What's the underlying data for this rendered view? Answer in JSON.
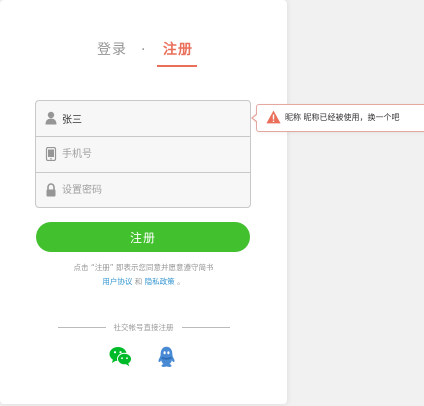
{
  "tabs": {
    "login": "登录",
    "separator": "·",
    "register": "注册"
  },
  "form": {
    "nickname_value": "张三",
    "phone_placeholder": "手机号",
    "password_placeholder": "设置密码"
  },
  "tooltip": {
    "message": "昵称 昵称已经被使用，换一个吧"
  },
  "register_button": "注册",
  "agreement": {
    "line1": "点击 “注册” 即表示您同意并愿意遵守简书",
    "user_agreement": "用户协议",
    "and": " 和 ",
    "privacy_policy": "隐私政策",
    "end": " 。"
  },
  "social": {
    "title": "社交帐号直接注册"
  },
  "colors": {
    "accent": "#ea6f5a",
    "button": "#42c02e",
    "link": "#3194d0"
  }
}
